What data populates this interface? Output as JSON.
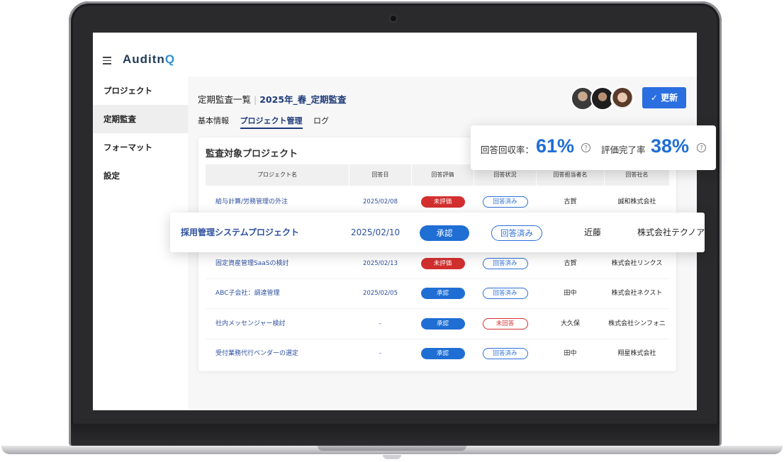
{
  "app": {
    "logo_text": "Auditn",
    "logo_q": "Q"
  },
  "sidebar": {
    "items": [
      {
        "label": "プロジェクト"
      },
      {
        "label": "定期監査"
      },
      {
        "label": "フォーマット"
      },
      {
        "label": "設定"
      }
    ]
  },
  "header": {
    "title": "定期監査一覧",
    "subtitle": "2025年_春_定期監査",
    "tabs": [
      "基本情報",
      "プロジェクト管理",
      "ログ"
    ],
    "update_label": "更新"
  },
  "card": {
    "title": "監査対象プロジェクト",
    "columns": [
      "プロジェクト名",
      "回答日",
      "回答評価",
      "回答状況",
      "回答担当者名",
      "回答社名"
    ],
    "rows": [
      {
        "name": "給与計算/労務管理の外注",
        "date": "2025/02/08",
        "eval": "未評価",
        "status": "回答済み",
        "person": "古賀",
        "company": "誠和株式会社"
      },
      {
        "name": "固定資産管理SaaSの検討",
        "date": "2025/02/13",
        "eval": "未評価",
        "status": "回答済み",
        "person": "古賀",
        "company": "株式会社リンクス"
      },
      {
        "name": "ABC子会社：調達管理",
        "date": "2025/02/05",
        "eval": "承認",
        "status": "回答済み",
        "person": "田中",
        "company": "株式会社ネクスト"
      },
      {
        "name": "社内メッセンジャー検討",
        "date": "-",
        "eval": "承認",
        "status": "未回答",
        "person": "大久保",
        "company": "株式会社シンフォニ"
      },
      {
        "name": "受付業務代行ベンダーの選定",
        "date": "-",
        "eval": "承認",
        "status": "回答済み",
        "person": "田中",
        "company": "翔星株式会社"
      }
    ]
  },
  "stats": {
    "response_rate_label": "回答回収率：",
    "response_rate_value": "61%",
    "evaluation_label": "評価完了率",
    "evaluation_value": "38%"
  },
  "highlight_row": {
    "name": "採用管理システムプロジェクト",
    "date": "2025/02/10",
    "eval": "承認",
    "status": "回答済み",
    "person": "近藤",
    "company": "株式会社テクノア"
  },
  "colors": {
    "primary": "#1f6ed4",
    "danger": "#d32f2f",
    "navy": "#1f3b78"
  }
}
